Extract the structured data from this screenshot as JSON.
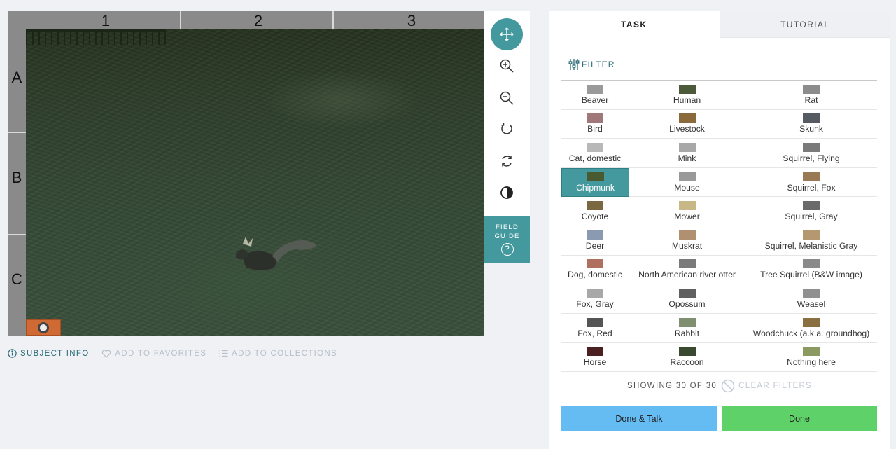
{
  "viewer": {
    "columns": [
      "1",
      "2",
      "3"
    ],
    "rows": [
      "A",
      "B",
      "C"
    ]
  },
  "toolbar": {
    "tools": [
      "move-icon",
      "zoom-in-icon",
      "zoom-out-icon",
      "rotate-icon",
      "reset-icon",
      "invert-icon"
    ],
    "field_guide": [
      "FIELD",
      "GUIDE"
    ],
    "field_guide_help": "?"
  },
  "meta": {
    "subject_info": "SUBJECT INFO",
    "add_favorites": "ADD TO FAVORITES",
    "add_collections": "ADD TO COLLECTIONS"
  },
  "tabs": {
    "task": "TASK",
    "tutorial": "TUTORIAL"
  },
  "filter_label": "FILTER",
  "choices": [
    {
      "label": "Beaver",
      "color": "#9a9a9a"
    },
    {
      "label": "Human",
      "color": "#4d5a3a"
    },
    {
      "label": "Rat",
      "color": "#8c8c8c"
    },
    {
      "label": "Bird",
      "color": "#a0787a"
    },
    {
      "label": "Livestock",
      "color": "#8a6a3a"
    },
    {
      "label": "Skunk",
      "color": "#555b60"
    },
    {
      "label": "Cat, domestic",
      "color": "#b8b8b8"
    },
    {
      "label": "Mink",
      "color": "#a8a8a8"
    },
    {
      "label": "Squirrel, Flying",
      "color": "#7a7a7a"
    },
    {
      "label": "Chipmunk",
      "color": "#4a5a30",
      "selected": true
    },
    {
      "label": "Mouse",
      "color": "#9a9a9a"
    },
    {
      "label": "Squirrel, Fox",
      "color": "#9a7a55"
    },
    {
      "label": "Coyote",
      "color": "#7a6840"
    },
    {
      "label": "Mower",
      "color": "#c8b888"
    },
    {
      "label": "Squirrel, Gray",
      "color": "#6a6a6a"
    },
    {
      "label": "Deer",
      "color": "#8a9ab0"
    },
    {
      "label": "Muskrat",
      "color": "#b09070"
    },
    {
      "label": "Squirrel, Melanistic Gray",
      "color": "#b39870"
    },
    {
      "label": "Dog, domestic",
      "color": "#b07060"
    },
    {
      "label": "North American river otter",
      "color": "#7a7a7a"
    },
    {
      "label": "Tree Squirrel (B&W image)",
      "color": "#8a8a8a"
    },
    {
      "label": "Fox, Gray",
      "color": "#a8a8a8"
    },
    {
      "label": "Opossum",
      "color": "#606060"
    },
    {
      "label": "Weasel",
      "color": "#909090"
    },
    {
      "label": "Fox, Red",
      "color": "#555555"
    },
    {
      "label": "Rabbit",
      "color": "#7f8f6f"
    },
    {
      "label": "Woodchuck (a.k.a. groundhog)",
      "color": "#8a7040"
    },
    {
      "label": "Horse",
      "color": "#4a2020"
    },
    {
      "label": "Raccoon",
      "color": "#3a4a30"
    },
    {
      "label": "Nothing here",
      "color": "#8a9a60"
    }
  ],
  "showing": "SHOWING 30 OF 30",
  "clear_filters": "CLEAR FILTERS",
  "buttons": {
    "done_talk": "Done & Talk",
    "done": "Done"
  },
  "colors": {
    "accent": "#43999e",
    "done_talk": "#65bcf3",
    "done": "#5fd169"
  }
}
